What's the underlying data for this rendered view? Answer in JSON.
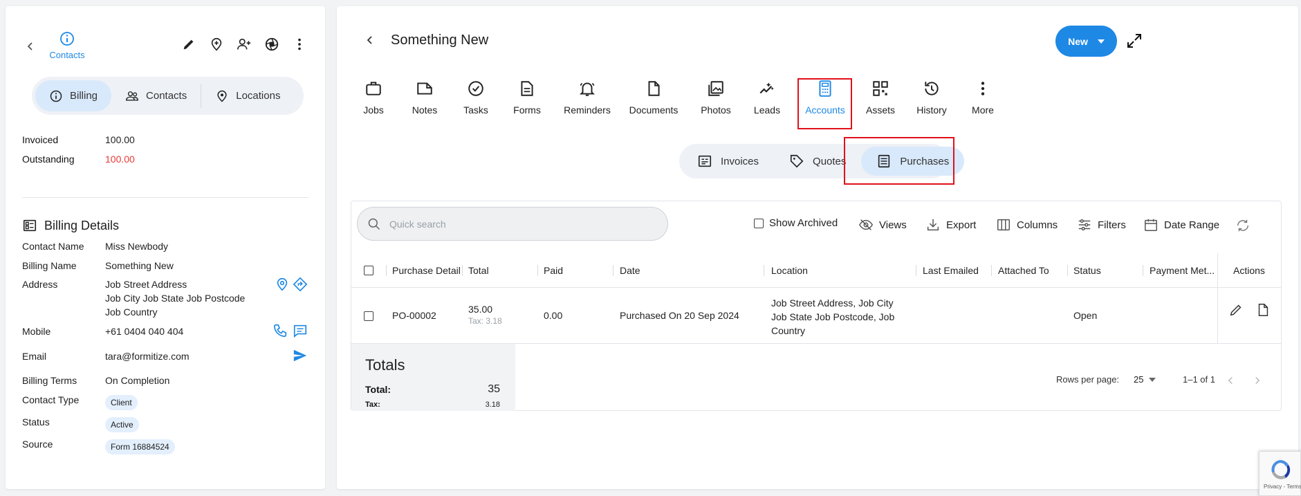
{
  "left": {
    "header_label": "Contacts",
    "segments": [
      {
        "label": "Billing",
        "icon": "info-icon"
      },
      {
        "label": "Contacts",
        "icon": "people-icon"
      },
      {
        "label": "Locations",
        "icon": "location-pin-icon"
      }
    ],
    "summary": {
      "invoiced_label": "Invoiced",
      "invoiced_value": "100.00",
      "outstanding_label": "Outstanding",
      "outstanding_value": "100.00"
    },
    "billing_details": {
      "title": "Billing Details",
      "contact_name_label": "Contact Name",
      "contact_name": "Miss Newbody",
      "billing_name_label": "Billing Name",
      "billing_name": "Something New",
      "address_label": "Address",
      "address_line1": "Job Street Address",
      "address_line2": "Job City Job State Job Postcode",
      "address_line3": "Job Country",
      "mobile_label": "Mobile",
      "mobile": "+61 0404 040 404",
      "email_label": "Email",
      "email": "tara@formitize.com",
      "billing_terms_label": "Billing Terms",
      "billing_terms": "On Completion",
      "contact_type_label": "Contact Type",
      "contact_type": "Client",
      "status_label": "Status",
      "status": "Active",
      "source_label": "Source",
      "source": "Form 16884524"
    }
  },
  "right": {
    "title": "Something New",
    "new_button": "New",
    "tabs": [
      {
        "label": "Jobs",
        "icon": "briefcase-icon"
      },
      {
        "label": "Notes",
        "icon": "note-icon"
      },
      {
        "label": "Tasks",
        "icon": "check-circle-icon"
      },
      {
        "label": "Forms",
        "icon": "form-doc-icon"
      },
      {
        "label": "Reminders",
        "icon": "bell-icon"
      },
      {
        "label": "Documents",
        "icon": "document-icon"
      },
      {
        "label": "Photos",
        "icon": "photos-icon"
      },
      {
        "label": "Leads",
        "icon": "leads-icon"
      },
      {
        "label": "Accounts",
        "icon": "calculator-icon"
      },
      {
        "label": "Assets",
        "icon": "qr-code-icon"
      },
      {
        "label": "History",
        "icon": "history-icon"
      },
      {
        "label": "More",
        "icon": "more-vertical-icon"
      }
    ],
    "active_tab": "Accounts",
    "subtabs": [
      {
        "label": "Invoices",
        "icon": "invoice-icon"
      },
      {
        "label": "Quotes",
        "icon": "tag-icon"
      },
      {
        "label": "Purchases",
        "icon": "purchases-icon"
      }
    ],
    "active_subtab": "Purchases",
    "search_placeholder": "Quick search",
    "toolbar": {
      "show_archived": "Show Archived",
      "views": "Views",
      "export": "Export",
      "columns": "Columns",
      "filters": "Filters",
      "date_range": "Date Range"
    },
    "columns": [
      "Purchase Detail",
      "Total",
      "Paid",
      "Date",
      "Location",
      "Last Emailed",
      "Attached To",
      "Status",
      "Payment Met...",
      "Actions"
    ],
    "rows": [
      {
        "purchase_detail": "PO-00002",
        "total": "35.00",
        "tax": "Tax: 3.18",
        "paid": "0.00",
        "date": "Purchased On 20 Sep 2024",
        "location_line1": "Job Street Address, Job City",
        "location_line2": "Job State Job Postcode, Job",
        "location_line3": "Country",
        "last_emailed": "",
        "attached_to": "",
        "status": "Open",
        "payment_method": ""
      }
    ],
    "totals": {
      "title": "Totals",
      "total_label": "Total:",
      "total_value": "35",
      "tax_label": "Tax:",
      "tax_value": "3.18"
    },
    "pagination": {
      "rows_per_page_label": "Rows per page:",
      "rows_per_page": "25",
      "range": "1–1 of 1"
    }
  },
  "recaptcha": {
    "text": "Privacy - Terms"
  },
  "colors": {
    "accent": "#1e88e5",
    "highlight": "#e0101a",
    "outstanding": "#e53935"
  }
}
